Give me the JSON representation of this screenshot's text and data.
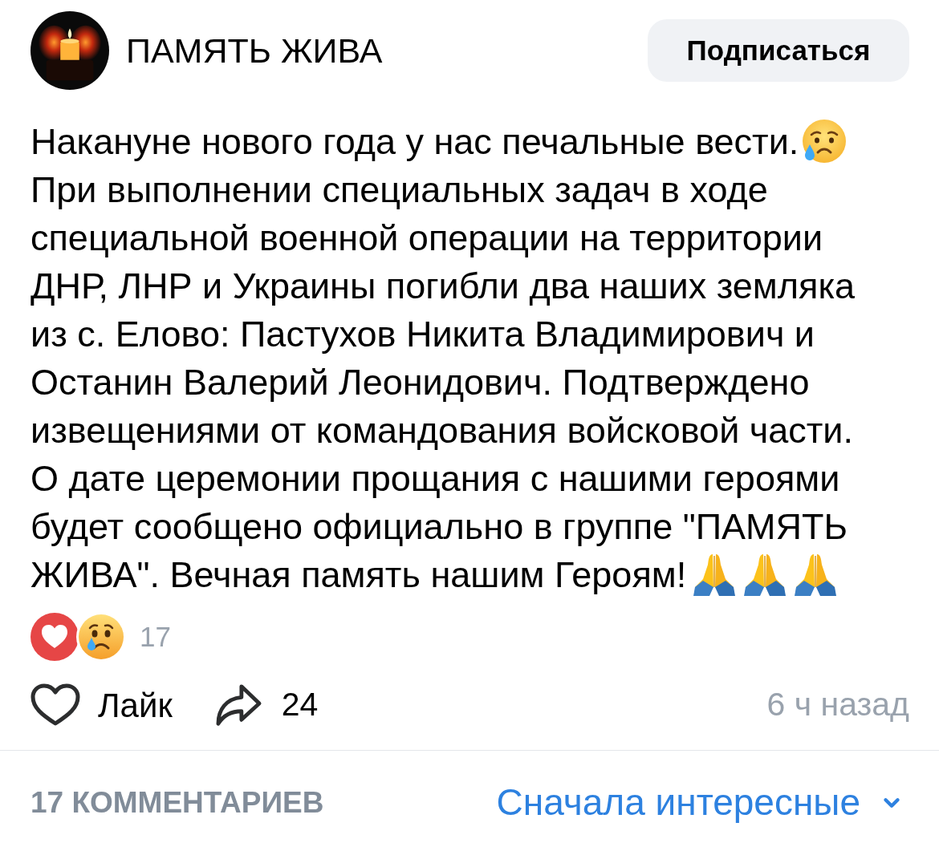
{
  "header": {
    "title": "ПАМЯТЬ ЖИВА",
    "subscribe_button": "Подписаться"
  },
  "post": {
    "body": [
      {
        "kind": "text",
        "text": "Накануне нового года у нас печальные вести."
      },
      {
        "kind": "tear"
      },
      {
        "kind": "text",
        "text": "При выполнении специальных задач в ходе специальной военной операции на территории ДНР, ЛНР и Украины погибли два наших земляка из с. Елово: Пастухов Никита Владимирович и Останин Валерий Леонидович. Подтверждено извещениями от командования войсковой части. О дате церемонии прощания с нашими героями будет сообщено официально в группе \"ПАМЯТЬ ЖИВА\". Вечная память нашим Героям!"
      },
      {
        "kind": "pray"
      },
      {
        "kind": "pray"
      },
      {
        "kind": "pray"
      }
    ]
  },
  "reactions": {
    "items": [
      {
        "kind": "heart"
      },
      {
        "kind": "crying"
      }
    ],
    "count": "17"
  },
  "actions": {
    "like": {
      "label": "Лайк",
      "liked": false
    },
    "share_count": "24",
    "time": "6 ч назад"
  },
  "comments": {
    "count_label": "17 КОММЕНТАРИЕВ",
    "sort": "Сначала интересные"
  }
}
